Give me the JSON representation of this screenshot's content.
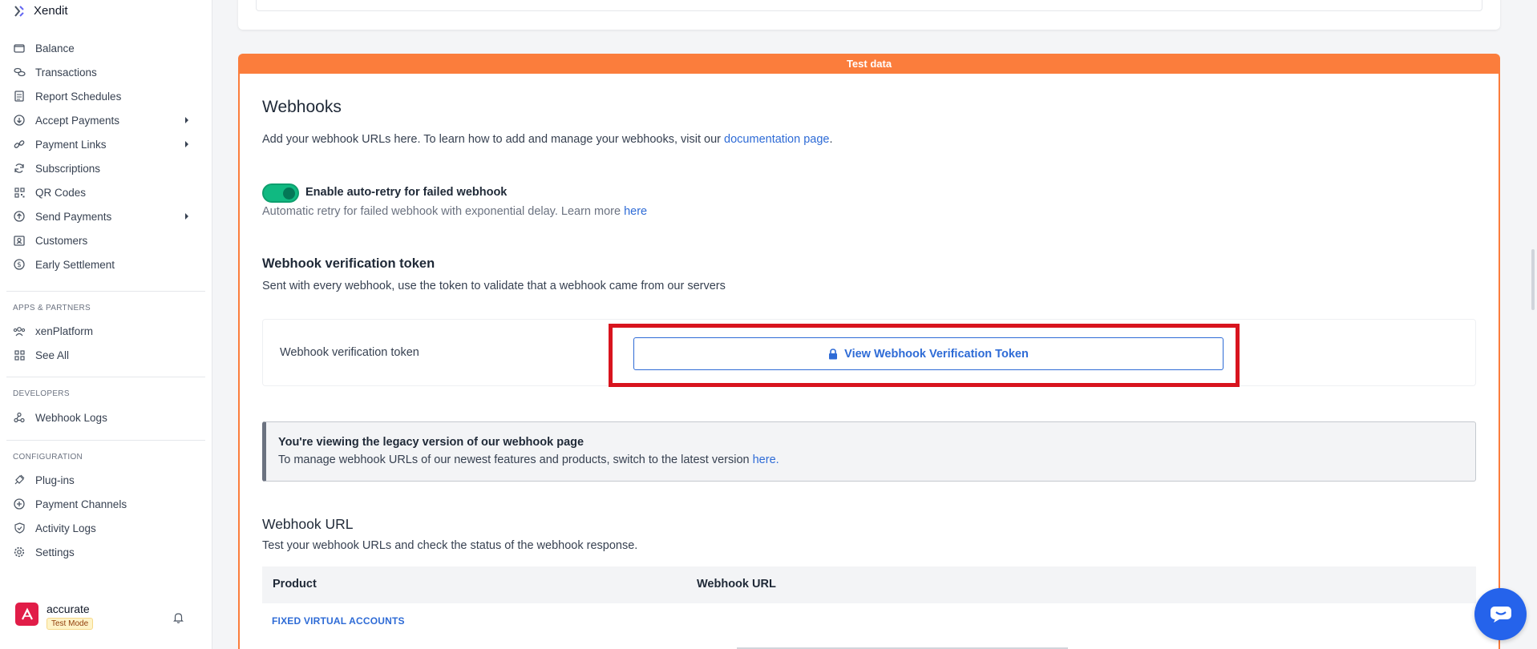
{
  "brand": {
    "name": "Xendit"
  },
  "sidebar": {
    "items": [
      {
        "label": "Balance",
        "icon": "wallet-icon",
        "has_submenu": false
      },
      {
        "label": "Transactions",
        "icon": "coins-icon",
        "has_submenu": false
      },
      {
        "label": "Report Schedules",
        "icon": "document-icon",
        "has_submenu": false
      },
      {
        "label": "Accept Payments",
        "icon": "arrow-down-circle-icon",
        "has_submenu": true
      },
      {
        "label": "Payment Links",
        "icon": "link-icon",
        "has_submenu": true
      },
      {
        "label": "Subscriptions",
        "icon": "refresh-icon",
        "has_submenu": false
      },
      {
        "label": "QR Codes",
        "icon": "qr-code-icon",
        "has_submenu": false
      },
      {
        "label": "Send Payments",
        "icon": "arrow-up-circle-icon",
        "has_submenu": true
      },
      {
        "label": "Customers",
        "icon": "id-card-icon",
        "has_submenu": false
      },
      {
        "label": "Early Settlement",
        "icon": "dollar-circle-icon",
        "has_submenu": false
      }
    ],
    "apps_section": {
      "label": "APPS & PARTNERS",
      "items": [
        {
          "label": "xenPlatform",
          "icon": "users-icon"
        },
        {
          "label": "See All",
          "icon": "grid-icon"
        }
      ]
    },
    "developers_section": {
      "label": "DEVELOPERS",
      "items": [
        {
          "label": "Webhook Logs",
          "icon": "webhook-icon"
        }
      ]
    },
    "configuration_section": {
      "label": "CONFIGURATION",
      "items": [
        {
          "label": "Plug-ins",
          "icon": "plug-icon"
        },
        {
          "label": "Payment Channels",
          "icon": "plus-circle-icon"
        },
        {
          "label": "Activity Logs",
          "icon": "shield-icon"
        },
        {
          "label": "Settings",
          "icon": "gear-icon"
        }
      ]
    },
    "account": {
      "name": "accurate",
      "mode": "Test Mode"
    }
  },
  "main": {
    "test_banner": "Test data",
    "title": "Webhooks",
    "description_prefix": "Add your webhook URLs here. To learn how to add and manage your webhooks, visit our ",
    "description_link": "documentation page",
    "description_suffix": ".",
    "auto_retry": {
      "enabled": true,
      "label": "Enable auto-retry for failed webhook",
      "sub_prefix": "Automatic retry for failed webhook with exponential delay. Learn more ",
      "sub_link": "here"
    },
    "token_section": {
      "title": "Webhook verification token",
      "description": "Sent with every webhook, use the token to validate that a webhook came from our servers",
      "field_label": "Webhook verification token",
      "button_label": "View Webhook Verification Token"
    },
    "legacy_notice": {
      "title": "You're viewing the legacy version of our webhook page",
      "text_prefix": "To manage webhook URLs of our newest features and products, switch to the latest version ",
      "link": "here."
    },
    "webhook_url": {
      "title": "Webhook URL",
      "description": "Test your webhook URLs and check the status of the webhook response.",
      "columns": [
        "Product",
        "Webhook URL"
      ],
      "rows": [
        {
          "product": "FIXED VIRTUAL ACCOUNTS"
        }
      ]
    }
  },
  "colors": {
    "accent_orange": "#fb7d3c",
    "link_blue": "#2e6bd6",
    "toggle_green": "#10b981",
    "highlight_red": "#d8141e",
    "chat_blue": "#2563eb"
  }
}
